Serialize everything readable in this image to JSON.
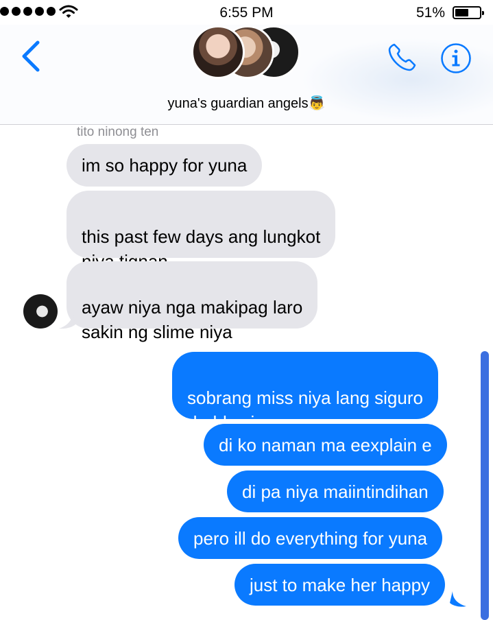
{
  "status_bar": {
    "time": "6:55 PM",
    "battery_percent": "51%",
    "signal_icon": "signal-dots-icon",
    "wifi_icon": "wifi-icon",
    "battery_icon": "battery-icon"
  },
  "header": {
    "back_icon": "chevron-left-icon",
    "group_name": "yuna's guardian angels👼",
    "phone_icon": "phone-icon",
    "info_icon": "info-icon",
    "accent_color": "#0a7aff"
  },
  "messages": {
    "sender_name": "tito ninong ten",
    "incoming": [
      "im so happy for yuna",
      "this past few days ang lungkot\nniya tignan",
      "ayaw niya nga makipag laro\nsakin ng slime niya"
    ],
    "outgoing": [
      "sobrang miss niya lang siguro\ndaddy niya",
      "di ko naman ma eexplain e",
      "di pa niya maiintindihan",
      "pero ill do everything for yuna",
      "just to make her happy"
    ]
  }
}
